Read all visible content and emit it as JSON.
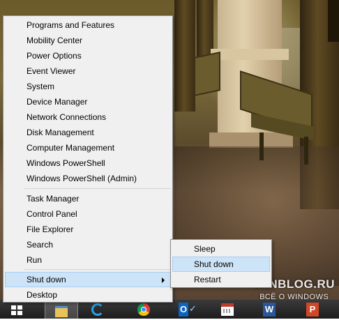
{
  "context_menu": {
    "group1": [
      "Programs and Features",
      "Mobility Center",
      "Power Options",
      "Event Viewer",
      "System",
      "Device Manager",
      "Network Connections",
      "Disk Management",
      "Computer Management",
      "Windows PowerShell",
      "Windows PowerShell (Admin)"
    ],
    "group2": [
      "Task Manager",
      "Control Panel",
      "File Explorer",
      "Search",
      "Run"
    ],
    "shut_down": "Shut down",
    "desktop": "Desktop"
  },
  "submenu": {
    "items": [
      "Sleep",
      "Shut down",
      "Restart"
    ],
    "highlighted": "Shut down"
  },
  "watermark": {
    "line1": "WINBLOG.RU",
    "line2": "ВСЁ О WINDOWS"
  },
  "taskbar": {
    "buttons": [
      "start-icon",
      "file-explorer-icon",
      "internet-explorer-icon",
      "chrome-icon",
      "outlook-icon",
      "calendar-icon",
      "word-icon",
      "powerpoint-icon"
    ],
    "outlook_letter": "O",
    "word_letter": "W",
    "ppt_letter": "P"
  },
  "colors": {
    "menu_bg": "#f0f0f0",
    "highlight": "#cde3f7",
    "highlight_border": "#a9cdf0"
  }
}
